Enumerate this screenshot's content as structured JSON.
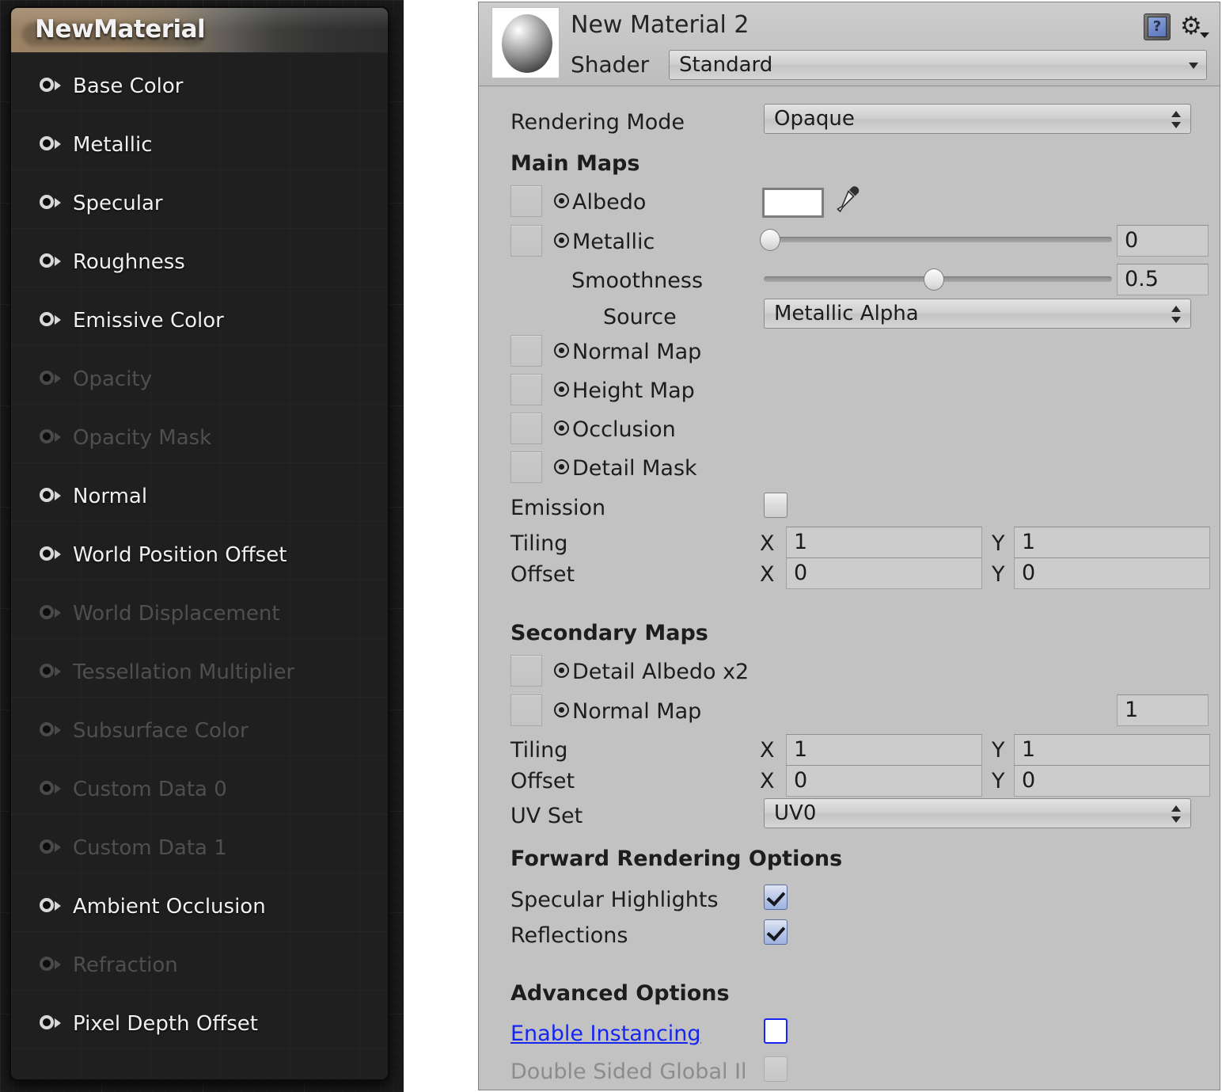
{
  "graph": {
    "node": {
      "title": "NewMaterial",
      "pins": [
        {
          "label": "Base Color",
          "enabled": true
        },
        {
          "label": "Metallic",
          "enabled": true
        },
        {
          "label": "Specular",
          "enabled": true
        },
        {
          "label": "Roughness",
          "enabled": true
        },
        {
          "label": "Emissive Color",
          "enabled": true
        },
        {
          "label": "Opacity",
          "enabled": false
        },
        {
          "label": "Opacity Mask",
          "enabled": false
        },
        {
          "label": "Normal",
          "enabled": true
        },
        {
          "label": "World Position Offset",
          "enabled": true
        },
        {
          "label": "World Displacement",
          "enabled": false
        },
        {
          "label": "Tessellation Multiplier",
          "enabled": false
        },
        {
          "label": "Subsurface Color",
          "enabled": false
        },
        {
          "label": "Custom Data 0",
          "enabled": false
        },
        {
          "label": "Custom Data 1",
          "enabled": false
        },
        {
          "label": "Ambient Occlusion",
          "enabled": true
        },
        {
          "label": "Refraction",
          "enabled": false
        },
        {
          "label": "Pixel Depth Offset",
          "enabled": true
        }
      ]
    }
  },
  "inspector": {
    "material_name": "New Material 2",
    "shader_label": "Shader",
    "shader_value": "Standard",
    "help_icon": "?",
    "gear_icon": "⚙",
    "rendering_mode_label": "Rendering Mode",
    "rendering_mode_value": "Opaque",
    "main_maps": {
      "heading": "Main Maps",
      "albedo_label": "Albedo",
      "albedo_color": "#ffffff",
      "metallic_label": "Metallic",
      "metallic_value": "0",
      "smoothness_label": "Smoothness",
      "smoothness_value": "0.5",
      "source_label": "Source",
      "source_value": "Metallic Alpha",
      "normal_map_label": "Normal Map",
      "height_map_label": "Height Map",
      "occlusion_label": "Occlusion",
      "detail_mask_label": "Detail Mask",
      "emission_label": "Emission",
      "tiling_label": "Tiling",
      "tiling_x_tag": "X",
      "tiling_x": "1",
      "tiling_y_tag": "Y",
      "tiling_y": "1",
      "offset_label": "Offset",
      "offset_x_tag": "X",
      "offset_x": "0",
      "offset_y_tag": "Y",
      "offset_y": "0"
    },
    "secondary_maps": {
      "heading": "Secondary Maps",
      "detail_albedo_label": "Detail Albedo x2",
      "normal_map_label": "Normal Map",
      "normal_map_value": "1",
      "tiling_label": "Tiling",
      "tiling_x_tag": "X",
      "tiling_x": "1",
      "tiling_y_tag": "Y",
      "tiling_y": "1",
      "offset_label": "Offset",
      "offset_x_tag": "X",
      "offset_x": "0",
      "offset_y_tag": "Y",
      "offset_y": "0",
      "uv_set_label": "UV Set",
      "uv_set_value": "UV0"
    },
    "forward_rendering": {
      "heading": "Forward Rendering Options",
      "specular_highlights_label": "Specular Highlights",
      "specular_highlights_checked": true,
      "reflections_label": "Reflections",
      "reflections_checked": true
    },
    "advanced": {
      "heading": "Advanced Options",
      "enable_instancing_label": "Enable Instancing",
      "enable_instancing_checked": false,
      "double_sided_gi_label": "Double Sided Global Il",
      "double_sided_gi_checked": false
    }
  },
  "colors": {
    "node_title_gradient_start": "#9b8265",
    "node_body_bg": "#1e1f1e",
    "inspector_bg": "#c2c2c2",
    "link_blue": "#1626ef",
    "checkbox_checked_blue": "#9fb2df"
  }
}
